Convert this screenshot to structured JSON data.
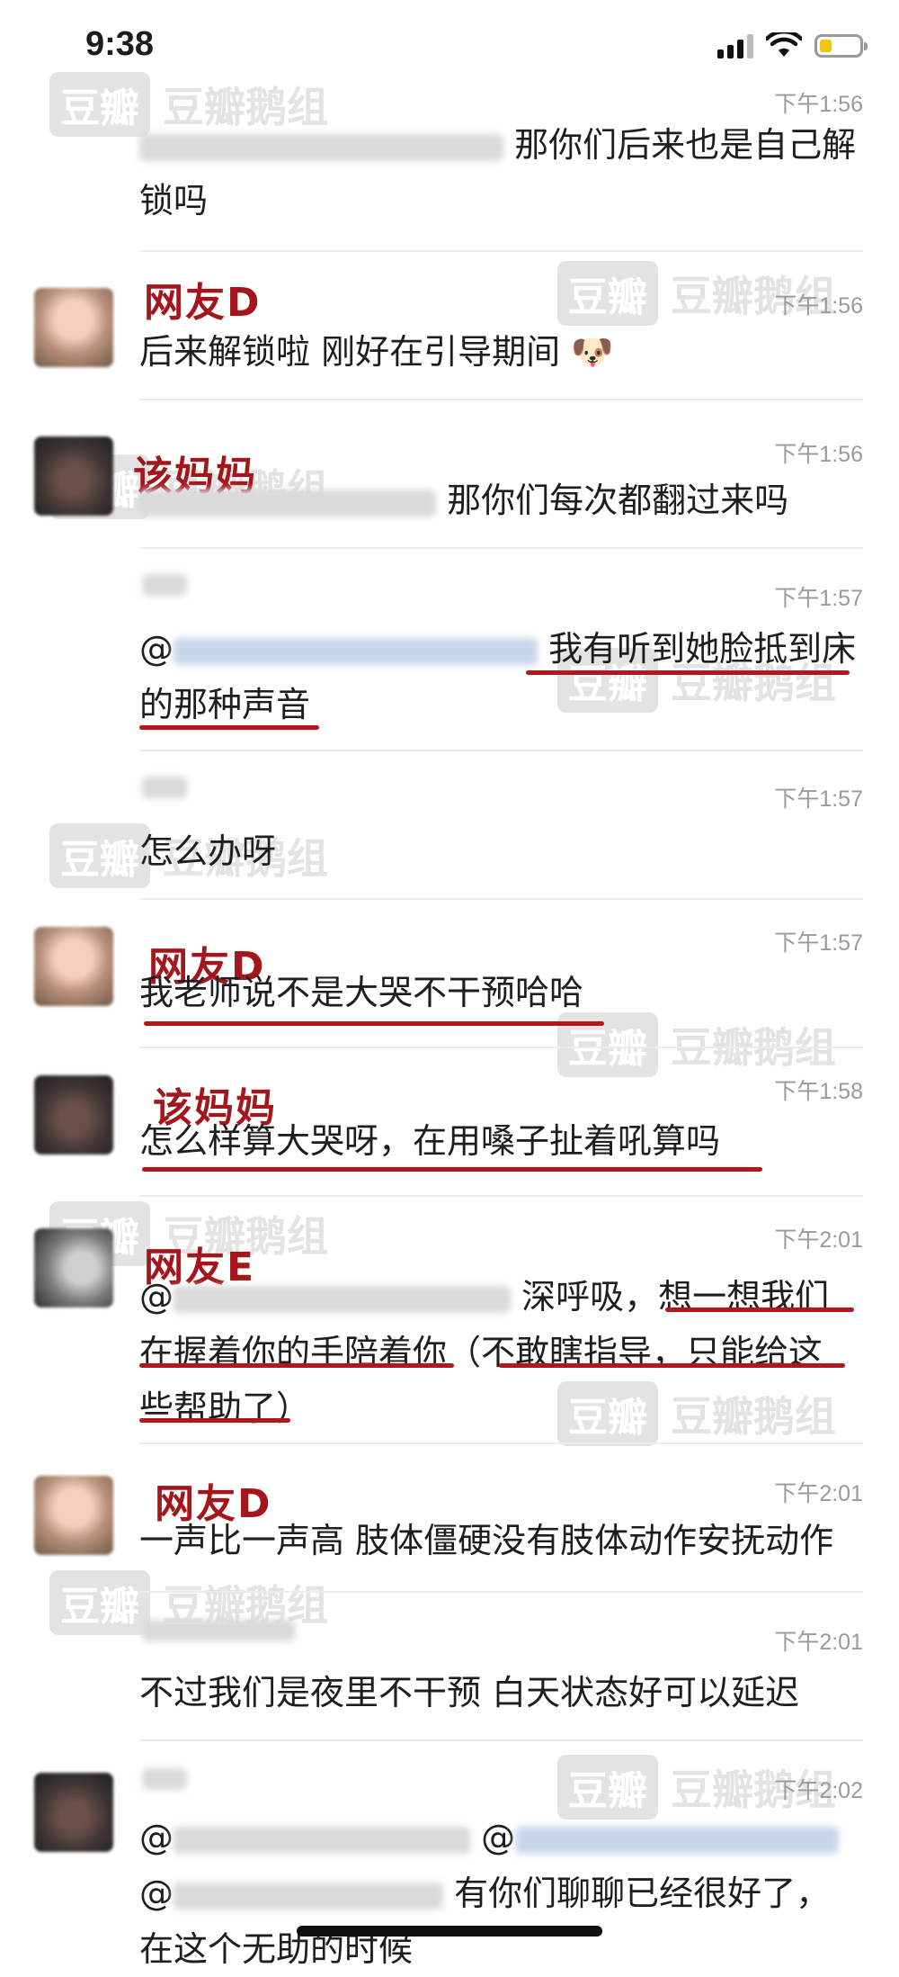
{
  "status_bar": {
    "time": "9:38",
    "battery_level": 0.3
  },
  "watermark": {
    "box": "豆瓣",
    "text": "豆瓣鹅组"
  },
  "messages": [
    {
      "id": "m1",
      "time": "下午1:56",
      "text_after_mention": "那你们后来也是自己解锁吗"
    },
    {
      "id": "m2",
      "nickname_label": "网友D",
      "time": "下午1:56",
      "text": "后来解锁啦 刚好在引导期间",
      "emoji": "🐶"
    },
    {
      "id": "m3",
      "nickname_label": "该妈妈",
      "time": "下午1:56",
      "text_after_mention": "那你们每次都翻过来吗"
    },
    {
      "id": "m4",
      "time": "下午1:57",
      "mention_prefix": "@",
      "text_line1": "我有听到她脸抵到床",
      "text_line2": "的那种声音"
    },
    {
      "id": "m5",
      "time": "下午1:57",
      "text": "怎么办呀"
    },
    {
      "id": "m6",
      "nickname_label": "网友D",
      "time": "下午1:57",
      "text": "我老师说不是大哭不干预哈哈"
    },
    {
      "id": "m7",
      "nickname_label": "该妈妈",
      "time": "下午1:58",
      "text": "怎么样算大哭呀，在用嗓子扯着吼算吗"
    },
    {
      "id": "m8",
      "nickname_label": "网友E",
      "time": "下午2:01",
      "mention_prefix": "@",
      "text_line1": "深呼吸，想一想我们",
      "text_line2": "在握着你的手陪着你（不敢瞎指导，只能给这",
      "text_line3": "些帮助了）"
    },
    {
      "id": "m9",
      "nickname_label": "网友D",
      "time": "下午2:01",
      "text": "一声比一声高 肢体僵硬没有肢体动作安抚动作"
    },
    {
      "id": "m10",
      "time": "下午2:01",
      "text": "不过我们是夜里不干预 白天状态好可以延迟"
    },
    {
      "id": "m11",
      "time": "下午2:02",
      "mention_prefix_1": "@",
      "mention_prefix_2": "@",
      "mention_prefix_3": "@",
      "text_line2": "有你们聊聊已经很好了，",
      "text_line3": "在这个无助的时候"
    }
  ]
}
